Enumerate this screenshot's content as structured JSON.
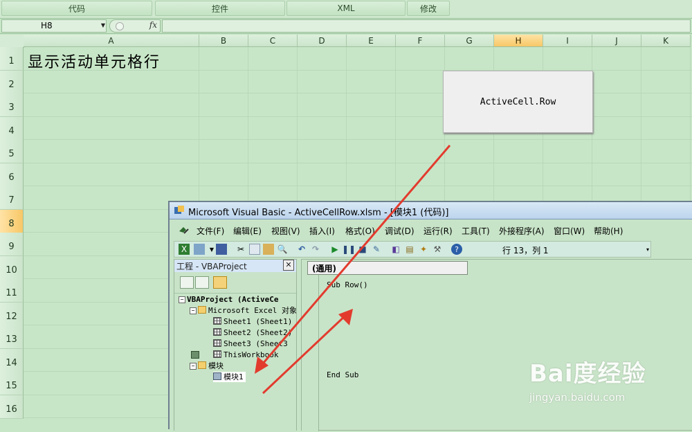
{
  "ribbon": {
    "groups": [
      "代码",
      "控件",
      "XML",
      "修改"
    ]
  },
  "formula_bar": {
    "name_box": "H8",
    "fx_label": "fx",
    "formula": ""
  },
  "sheet": {
    "columns": [
      "A",
      "B",
      "C",
      "D",
      "E",
      "F",
      "G",
      "H",
      "I",
      "J",
      "K"
    ],
    "selected_column": "H",
    "rows": [
      "1",
      "2",
      "3",
      "4",
      "5",
      "6",
      "7",
      "8",
      "9",
      "10",
      "11",
      "12",
      "13",
      "14",
      "15",
      "16"
    ],
    "selected_row": "8",
    "cell_a1": "显示活动单元格行"
  },
  "macro_button": {
    "label": "ActiveCell.Row"
  },
  "vbe": {
    "title": "Microsoft Visual Basic - ActiveCellRow.xlsm - [模块1 (代码)]",
    "menu": [
      "文件(F)",
      "编辑(E)",
      "视图(V)",
      "插入(I)",
      "格式(O)",
      "调试(D)",
      "运行(R)",
      "工具(T)",
      "外接程序(A)",
      "窗口(W)",
      "帮助(H)"
    ],
    "cursor_position": "行 13，列 1",
    "project_panel": {
      "title": "工程 - VBAProject",
      "close": "✕",
      "tree": {
        "project": "VBAProject (ActiveCe",
        "excel_objects_folder": "Microsoft Excel 对象",
        "sheets": [
          "Sheet1 (Sheet1)",
          "Sheet2 (Sheet2)",
          "Sheet3 (Sheet3"
        ],
        "workbook": "ThisWorkbook",
        "modules_folder": "模块",
        "module1": "模块1"
      }
    },
    "code_window": {
      "object_combo": "(通用)",
      "lines": [
        "Sub Row()",
        "End Sub"
      ]
    }
  },
  "watermark": {
    "logo": "Bai度经验",
    "url": "jingyan.baidu.com"
  },
  "colors": {
    "sheet_bg": "#c7e6c7",
    "selected_header": "#f7c766",
    "arrow": "#e23b2e"
  }
}
